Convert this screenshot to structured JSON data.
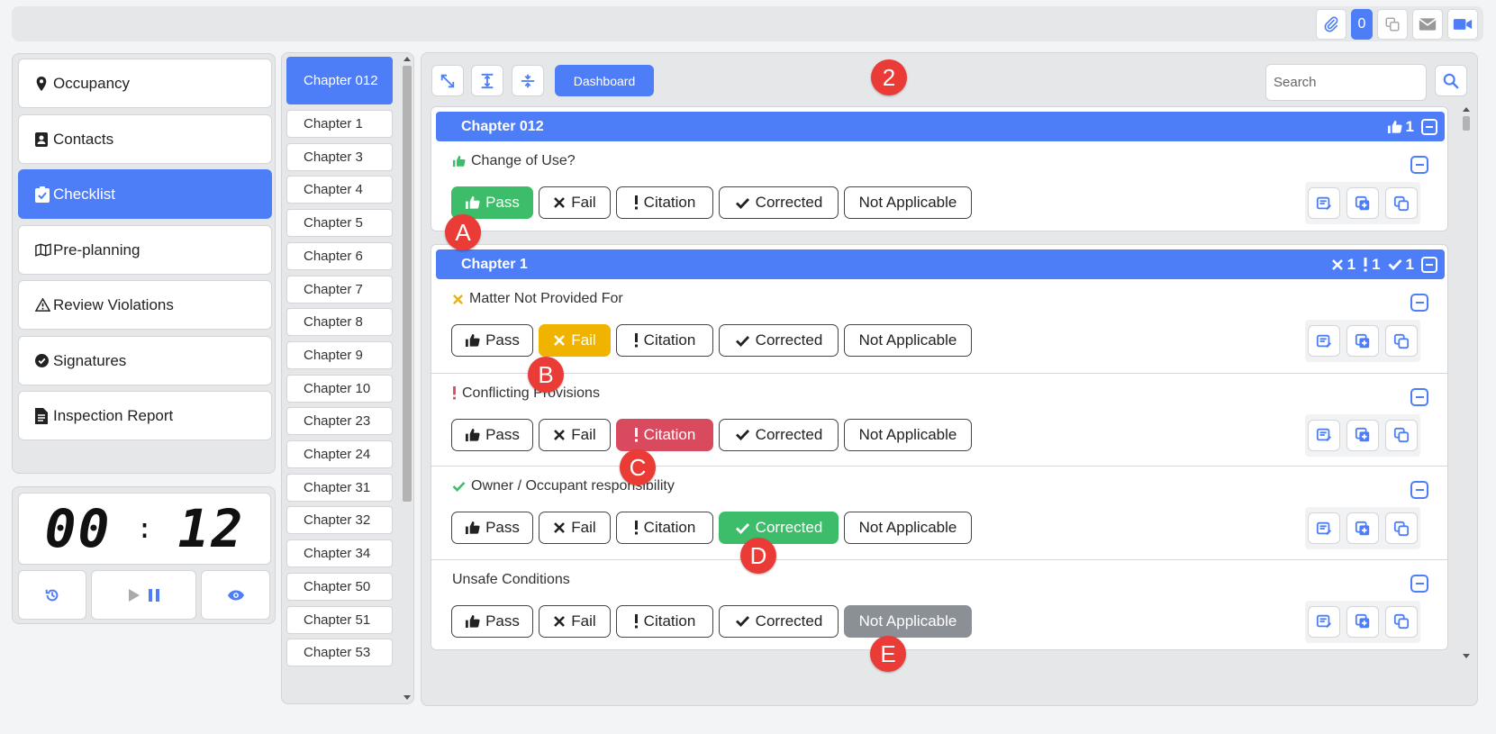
{
  "topbar": {
    "badge_count": "0"
  },
  "nav": {
    "items": [
      {
        "label": "Occupancy",
        "icon": "map-pin-icon"
      },
      {
        "label": "Contacts",
        "icon": "contact-card-icon"
      },
      {
        "label": "Checklist",
        "icon": "clipboard-check-icon",
        "active": true
      },
      {
        "label": "Pre-planning",
        "icon": "map-icon"
      },
      {
        "label": "Review Violations",
        "icon": "warning-triangle-icon"
      },
      {
        "label": "Signatures",
        "icon": "check-circle-icon"
      },
      {
        "label": "Inspection Report",
        "icon": "document-icon"
      }
    ]
  },
  "timer": {
    "minutes": "00",
    "separator": ":",
    "seconds": "12"
  },
  "chapters": [
    "Chapter 012",
    "Chapter 1",
    "Chapter 3",
    "Chapter 4",
    "Chapter 5",
    "Chapter 6",
    "Chapter 7",
    "Chapter 8",
    "Chapter 9",
    "Chapter 10",
    "Chapter 23",
    "Chapter 24",
    "Chapter 31",
    "Chapter 32",
    "Chapter 34",
    "Chapter 50",
    "Chapter 51",
    "Chapter 53"
  ],
  "toolbar": {
    "dashboard_label": "Dashboard",
    "search_placeholder": "Search"
  },
  "option_labels": {
    "pass": "Pass",
    "fail": "Fail",
    "citation": "Citation",
    "corrected": "Corrected",
    "na": "Not Applicable"
  },
  "sections": [
    {
      "title": "Chapter 012",
      "counts": {
        "pass": "1"
      },
      "items": [
        {
          "question": "Change of Use?",
          "selected": "pass"
        }
      ]
    },
    {
      "title": "Chapter 1",
      "counts": {
        "fail": "1",
        "citation": "1",
        "corrected": "1"
      },
      "items": [
        {
          "question": "Matter Not Provided For",
          "selected": "fail"
        },
        {
          "question": "Conflicting Provisions",
          "selected": "citation"
        },
        {
          "question": "Owner / Occupant responsibility",
          "selected": "corrected"
        },
        {
          "question": "Unsafe Conditions",
          "selected": "na"
        }
      ]
    }
  ],
  "markers": [
    "2",
    "A",
    "B",
    "C",
    "D",
    "E"
  ],
  "colors": {
    "accent": "#4d7ef7",
    "pass": "#3dbd6a",
    "fail": "#f0b400",
    "citation": "#d94a5f",
    "na": "#8b9097",
    "marker": "#ea3b37"
  }
}
